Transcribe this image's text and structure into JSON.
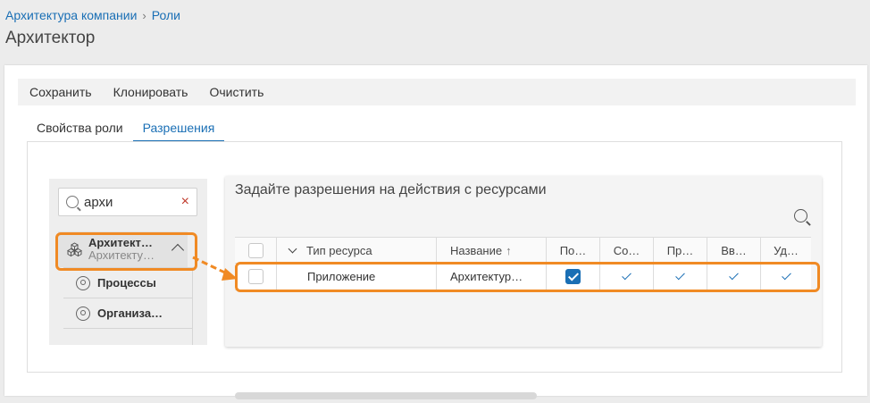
{
  "breadcrumb": {
    "parent": "Архитектура компании",
    "separator": "›",
    "current": "Роли"
  },
  "page_title": "Архитектор",
  "toolbar": {
    "save": "Сохранить",
    "clone": "Клонировать",
    "clear": "Очистить"
  },
  "tabs": [
    {
      "label": "Свойства роли",
      "active": false
    },
    {
      "label": "Разрешения",
      "active": true
    }
  ],
  "tree": {
    "search_value": "архи",
    "clear_icon": "×",
    "main_node": {
      "title": "Архитект…",
      "subtitle": "Архитекту…",
      "icon": "cubes-icon",
      "expanded": true
    },
    "children": [
      {
        "label": "Процессы",
        "icon": "target-icon"
      },
      {
        "label": "Организа…",
        "icon": "target-icon"
      }
    ]
  },
  "permissions": {
    "title": "Задайте разрешения на действия с ресурсами",
    "columns": {
      "type": "Тип ресурса",
      "name": "Название",
      "name_sort": "↑",
      "c1": "По…",
      "c2": "Со…",
      "c3": "Пр…",
      "c4": "Вв…",
      "c5": "Уд…"
    },
    "rows": [
      {
        "type": "Приложение",
        "name": "Архитектур…",
        "c1": true,
        "c2": true,
        "c3": true,
        "c4": true,
        "c5": true
      }
    ]
  },
  "colors": {
    "accent": "#1a6fb5",
    "highlight": "#f08a24",
    "danger": "#c0392b"
  }
}
